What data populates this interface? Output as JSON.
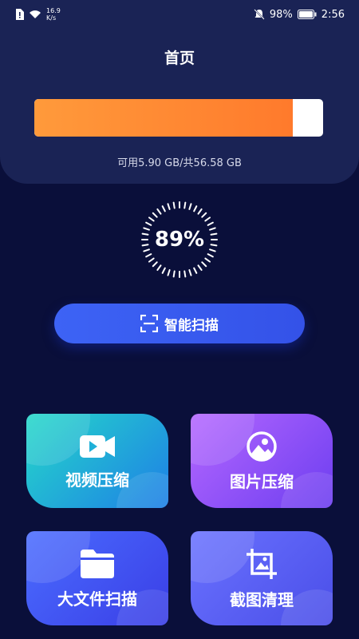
{
  "status_bar": {
    "net_speed_value": "16.9",
    "net_speed_unit": "K/s",
    "battery": "98%",
    "time": "2:56"
  },
  "header": {
    "title": "首页"
  },
  "storage": {
    "used_fraction": 0.894,
    "text": "可用5.90 GB/共56.58 GB",
    "fill_color": "#ff8a33"
  },
  "gauge": {
    "percent_label": "89%"
  },
  "scan_button": {
    "label": "智能扫描"
  },
  "cards": [
    {
      "label": "视频压缩",
      "icon": "video-icon"
    },
    {
      "label": "图片压缩",
      "icon": "image-icon"
    },
    {
      "label": "大文件扫描",
      "icon": "folder-icon"
    },
    {
      "label": "截图清理",
      "icon": "crop-icon"
    }
  ],
  "colors": {
    "background": "#0a0f3a",
    "header_panel": "#1a2355",
    "accent_blue": "#3d63f5"
  }
}
